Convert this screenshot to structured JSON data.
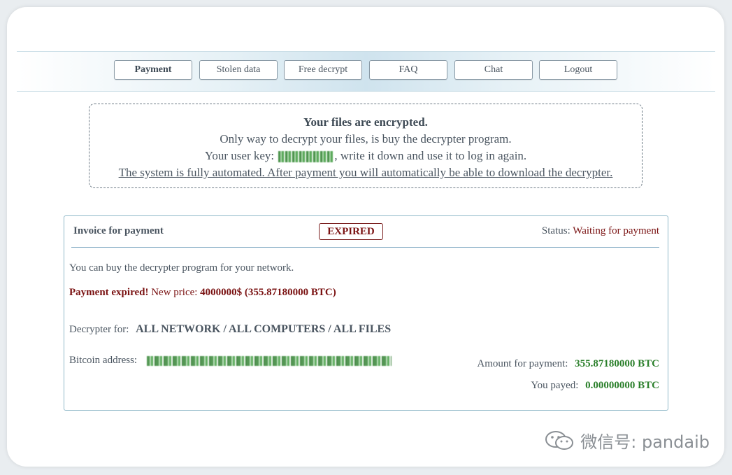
{
  "nav": {
    "buttons": [
      "Payment",
      "Stolen data",
      "Free decrypt",
      "FAQ",
      "Chat",
      "Logout"
    ],
    "active": "Payment"
  },
  "notice": {
    "title": "Your files are encrypted.",
    "line2": "Only way to decrypt your files, is buy the decrypter program.",
    "line3_before": "Your user key:",
    "line3_after": ", write it down and use it to log in again.",
    "line4": "The system is fully automated. After payment you will automatically be able to download the decrypter."
  },
  "invoice": {
    "title": "Invoice for payment",
    "badge": "EXPIRED",
    "status_label": "Status:",
    "status_value": "Waiting for payment",
    "intro": "You can buy the decrypter program for your network.",
    "expired_label": "Payment expired!",
    "new_price_label": "New price:",
    "new_price_value": "4000000$",
    "new_price_btc": "(355.87180000 BTC)",
    "decrypter_for_label": "Decrypter for:",
    "decrypter_for_value": "ALL NETWORK / ALL COMPUTERS / ALL FILES",
    "bitcoin_label": "Bitcoin address:",
    "amount_label": "Amount for payment:",
    "amount_value": "355.87180000 BTC",
    "payed_label": "You payed:",
    "payed_value": "0.00000000 BTC"
  },
  "watermark": {
    "text": "微信号: pandaib",
    "icon": "wechat-icon"
  },
  "colors": {
    "accent_red": "#7a1212",
    "accent_green": "#2a7f2a",
    "border_blue": "#8fb8c8"
  }
}
